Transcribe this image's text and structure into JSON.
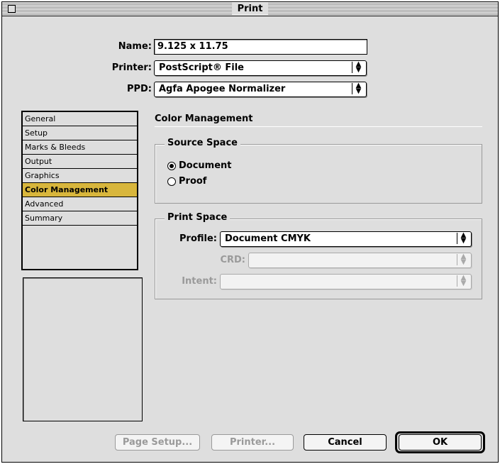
{
  "window": {
    "title": "Print"
  },
  "form": {
    "name_label": "Name:",
    "name_value": "9.125 x 11.75",
    "printer_label": "Printer:",
    "printer_value": "PostScript® File",
    "ppd_label": "PPD:",
    "ppd_value": "Agfa Apogee Normalizer"
  },
  "sidebar": {
    "items": [
      {
        "label": "General"
      },
      {
        "label": "Setup"
      },
      {
        "label": "Marks & Bleeds"
      },
      {
        "label": "Output"
      },
      {
        "label": "Graphics"
      },
      {
        "label": "Color Management"
      },
      {
        "label": "Advanced"
      },
      {
        "label": "Summary"
      }
    ],
    "selected_index": 5,
    "selected_color": "#d8b63c"
  },
  "panel": {
    "title": "Color Management",
    "source_space": {
      "label": "Source Space",
      "options": [
        {
          "label": "Document",
          "selected": true
        },
        {
          "label": "Proof",
          "selected": false
        }
      ]
    },
    "print_space": {
      "label": "Print Space",
      "profile_label": "Profile:",
      "profile_value": "Document CMYK",
      "crd_label": "CRD:",
      "crd_value": "",
      "intent_label": "Intent:",
      "intent_value": ""
    }
  },
  "buttons": {
    "page_setup": "Page Setup...",
    "printer": "Printer...",
    "cancel": "Cancel",
    "ok": "OK"
  },
  "icons": {
    "popup_arrows": "up-down-arrows-icon",
    "window_close": "close-box-icon"
  }
}
